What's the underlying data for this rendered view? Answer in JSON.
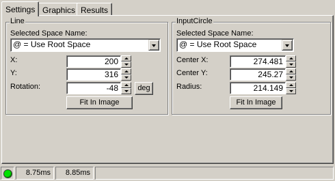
{
  "tabs": [
    "Settings",
    "Graphics",
    "Results"
  ],
  "line": {
    "title": "Line",
    "space_label": "Selected Space Name:",
    "space_value": "@ = Use Root Space",
    "x_label": "X:",
    "x_value": "200",
    "y_label": "Y:",
    "y_value": "316",
    "rotation_label": "Rotation:",
    "rotation_value": "-48",
    "unit_button": "deg",
    "fit_button": "Fit In Image"
  },
  "circle": {
    "title": "InputCircle",
    "space_label": "Selected Space Name:",
    "space_value": "@ = Use Root Space",
    "cx_label": "Center X:",
    "cx_value": "274.481",
    "cy_label": "Center Y:",
    "cy_value": "245.27",
    "radius_label": "Radius:",
    "radius_value": "214.149",
    "fit_button": "Fit In Image"
  },
  "status": {
    "indicator_color": "#00e000",
    "time1": "8.75ms",
    "time2": "8.85ms"
  }
}
